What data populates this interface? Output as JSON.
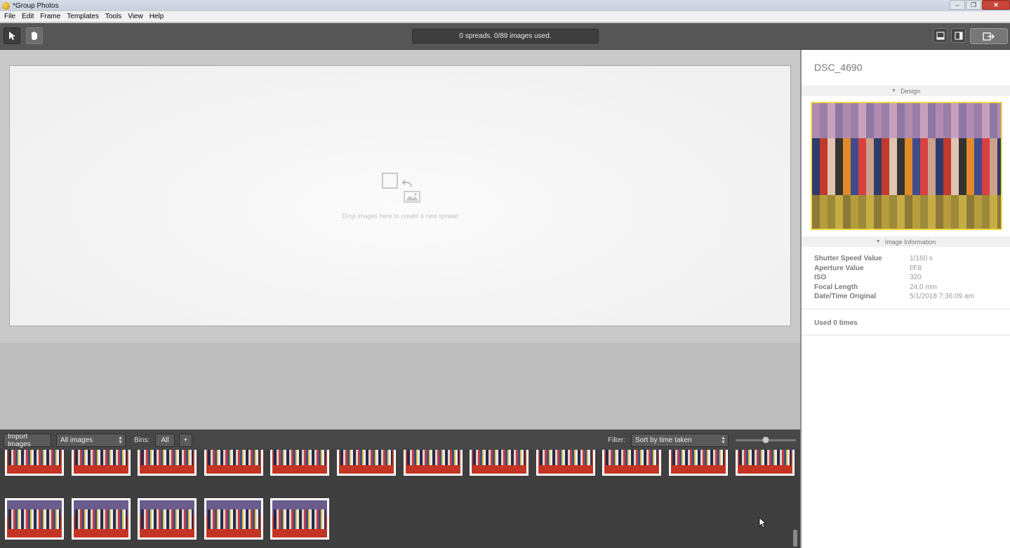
{
  "window": {
    "title": "*Group Photos",
    "controls": [
      "–",
      "❐",
      "✕"
    ]
  },
  "menu": [
    "File",
    "Edit",
    "Frame",
    "Templates",
    "Tools",
    "View",
    "Help"
  ],
  "toolbar": {
    "status": "0 spreads. 0/89 images used."
  },
  "canvas": {
    "drop_text": "Drop images here to create a new spread"
  },
  "filmbar": {
    "import_label": "Import Images",
    "images_select": "All images",
    "bins_label": "Bins:",
    "bins_all": "All",
    "bins_add": "+",
    "filter_label": "Filter:",
    "sort_select": "Sort by time taken",
    "zoom_level": 0.5
  },
  "filmstrip": {
    "thumbnail_count": 17,
    "row1_count": 12,
    "row2_count": 5
  },
  "panel": {
    "image_name": "DSC_4690",
    "design_header": "Design",
    "info_header": "Image Information",
    "info": [
      {
        "key": "Shutter Speed Value",
        "value": "1/160 s"
      },
      {
        "key": "Aperture Value",
        "value": "f/F8"
      },
      {
        "key": "ISO",
        "value": "320"
      },
      {
        "key": "Focal Length",
        "value": "24.0 mm"
      },
      {
        "key": "Date/Time Original",
        "value": "5/1/2018 7:36:09 am"
      }
    ],
    "used": "Used 0 times"
  },
  "colors": {
    "toolbar_bg": "#565656",
    "filmstrip_bg": "#3f3f3f",
    "preview_border": "#f2dc4a"
  }
}
